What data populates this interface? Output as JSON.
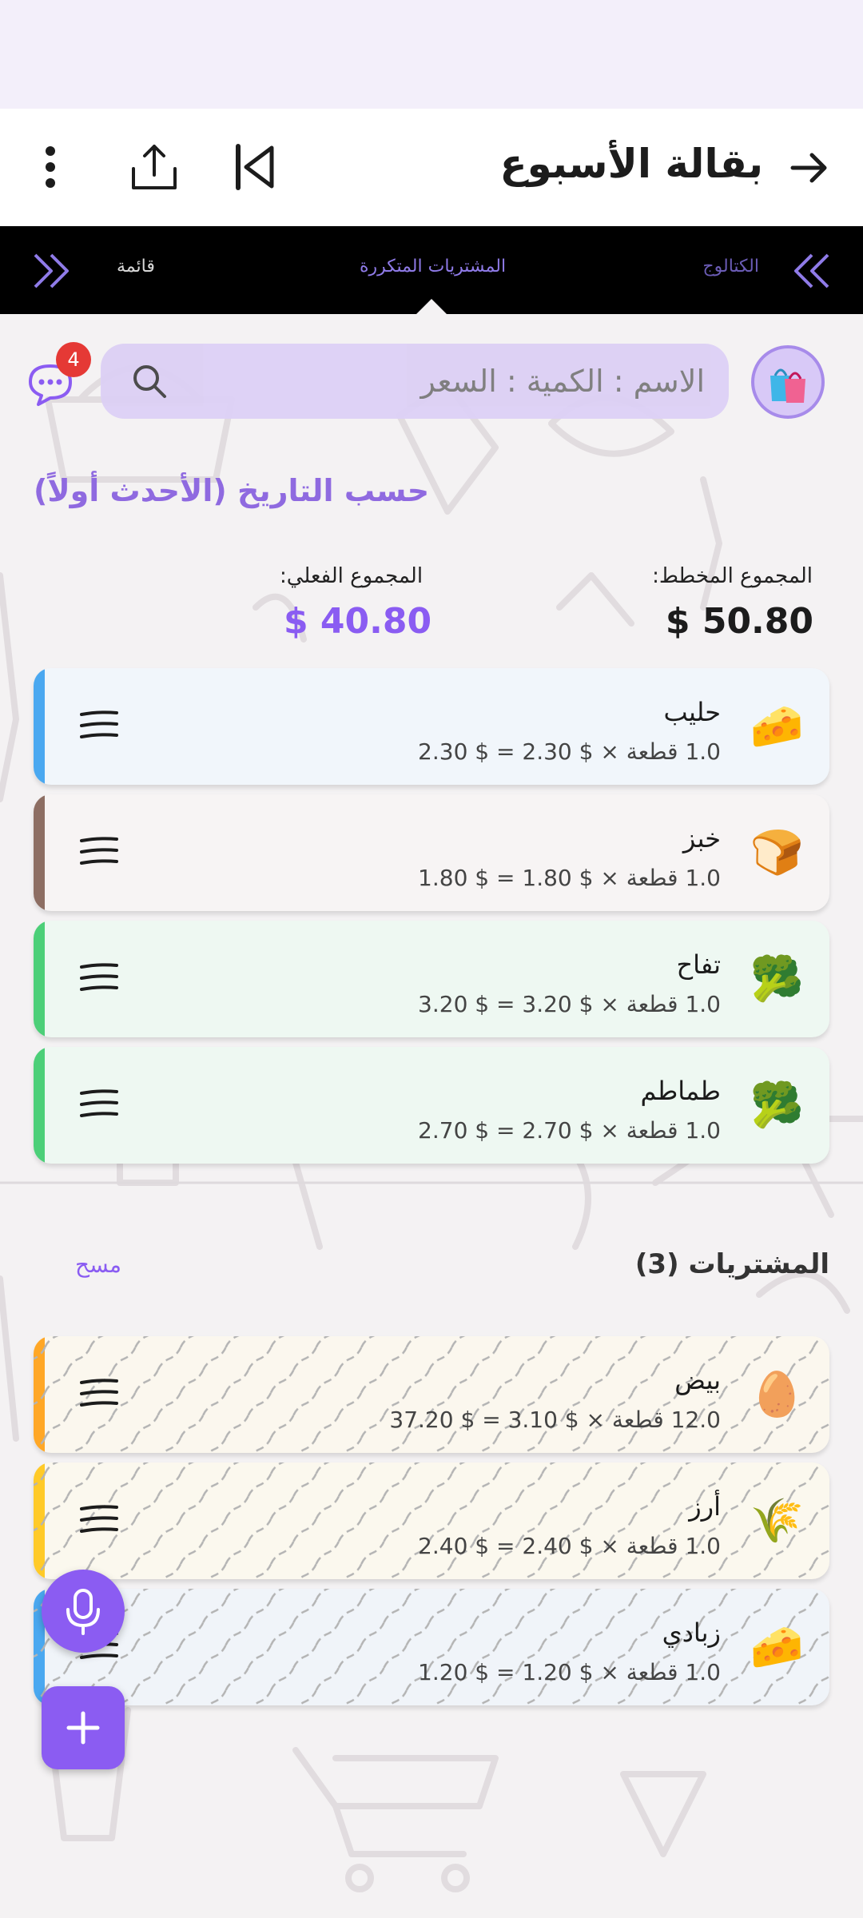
{
  "app_bar": {
    "title": "بقالة الأسبوع",
    "icons": [
      "arrow-right-icon",
      "skip-first-icon",
      "share-icon",
      "more-vert-icon"
    ]
  },
  "tabs": {
    "catalog": "الكتالوج",
    "recurring": "المشتريات المتكررة",
    "list": "قائمة",
    "active_color": "#8f7be8"
  },
  "search": {
    "placeholder": "الاسم : الكمية : السعر"
  },
  "chat": {
    "badge_count": "4"
  },
  "sort": {
    "label": "حسب التاريخ (الأحدث أولاً)"
  },
  "totals": {
    "planned_label": "المجموع المخطط:",
    "planned_value": "$ 50.80",
    "actual_label": "المجموع الفعلي:",
    "actual_value": "$ 40.80"
  },
  "items": [
    {
      "emoji": "🧀",
      "name": "حليب",
      "detail": "1.0 قطعة × $ 2.30 = $ 2.30",
      "stripe": "#4aa8f0",
      "bg": "#f1f6fb"
    },
    {
      "emoji": "🍞",
      "name": "خبز",
      "detail": "1.0 قطعة × $ 1.80 = $ 1.80",
      "stripe": "#8d6e63",
      "bg": "#f7f4f4"
    },
    {
      "emoji": "🥦",
      "name": "تفاح",
      "detail": "1.0 قطعة × $ 3.20 = $ 3.20",
      "stripe": "#4ccf78",
      "bg": "#eef8f2"
    },
    {
      "emoji": "🥦",
      "name": "طماطم",
      "detail": "1.0 قطعة × $ 2.70 = $ 2.70",
      "stripe": "#4ccf78",
      "bg": "#eef8f2"
    }
  ],
  "purchases": {
    "title": "المشتريات (3)",
    "clear_label": "مسح",
    "items": [
      {
        "emoji": "🥚",
        "name": "بيض",
        "detail": "12.0 قطعة × $ 3.10 = $ 37.20",
        "stripe": "#ffa726",
        "bg": "#fbf7ee"
      },
      {
        "emoji": "🌾",
        "name": "أرز",
        "detail": "1.0 قطعة × $ 2.40 = $ 2.40",
        "stripe": "#ffca28",
        "bg": "#fbf8ee"
      },
      {
        "emoji": "🧀",
        "name": "زبادي",
        "detail": "1.0 قطعة × $ 1.20 = $ 1.20",
        "stripe": "#4aa8f0",
        "bg": "#f0f4f9"
      }
    ]
  },
  "fabs": {
    "mic": "mic-icon",
    "add": "plus-icon"
  }
}
